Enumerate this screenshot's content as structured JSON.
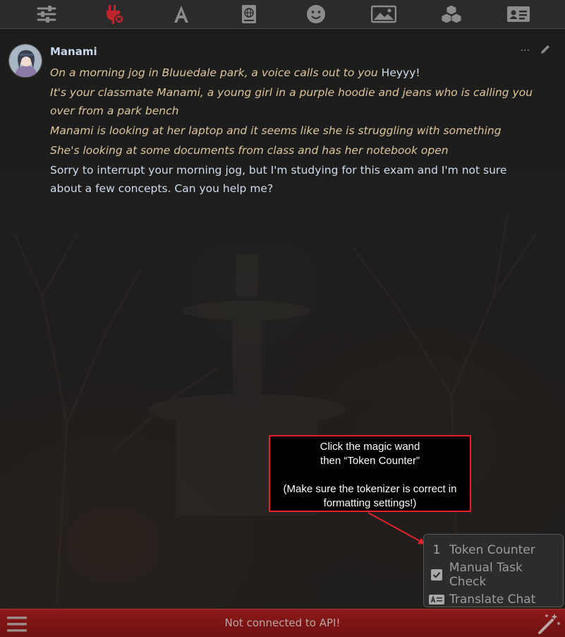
{
  "toolbar": {
    "icons": [
      "sliders-icon",
      "plug-icon",
      "font-icon",
      "book-globe-icon",
      "smiley-icon",
      "image-icon",
      "cubes-icon",
      "id-card-icon"
    ],
    "active_color": "#c0242c",
    "icon_color": "#8c8c8c"
  },
  "message": {
    "name": "Manami",
    "actions": [
      "···",
      "✎"
    ],
    "paragraphs": [
      {
        "narration": "On a morning jog in Bluuedale park, a voice calls out to you",
        "speech": " Heyyy!"
      },
      {
        "narration": "It's your classmate Manami, a young girl in a purple hoodie and jeans who is calling you over from a park bench",
        "speech": ""
      },
      {
        "narration": "Manami is looking at her laptop and it seems like she is struggling with something",
        "speech": ""
      },
      {
        "narration": "She's looking at some documents from class and has her notebook open",
        "speech": ""
      },
      {
        "narration": "",
        "speech": "Sorry to interrupt your morning jog, but I'm studying for this exam and I'm not sure about a few concepts. Can you help me?"
      }
    ]
  },
  "annotation": {
    "line1": "Click the magic wand",
    "line2": "then “Token Counter”",
    "line3": "(Make sure the tokenizer is correct in",
    "line4": "formatting settings!)",
    "border_color": "#e1222a"
  },
  "menu": {
    "items": [
      {
        "icon": "number-one-icon",
        "glyph": "1",
        "label": "Token Counter"
      },
      {
        "icon": "checkbox-icon",
        "glyph": "",
        "label": "Manual Task Check"
      },
      {
        "icon": "language-card-icon",
        "glyph": "",
        "label": "Translate Chat"
      }
    ]
  },
  "bottombar": {
    "status": "Not connected to API!",
    "color": "#8f1a1a"
  }
}
